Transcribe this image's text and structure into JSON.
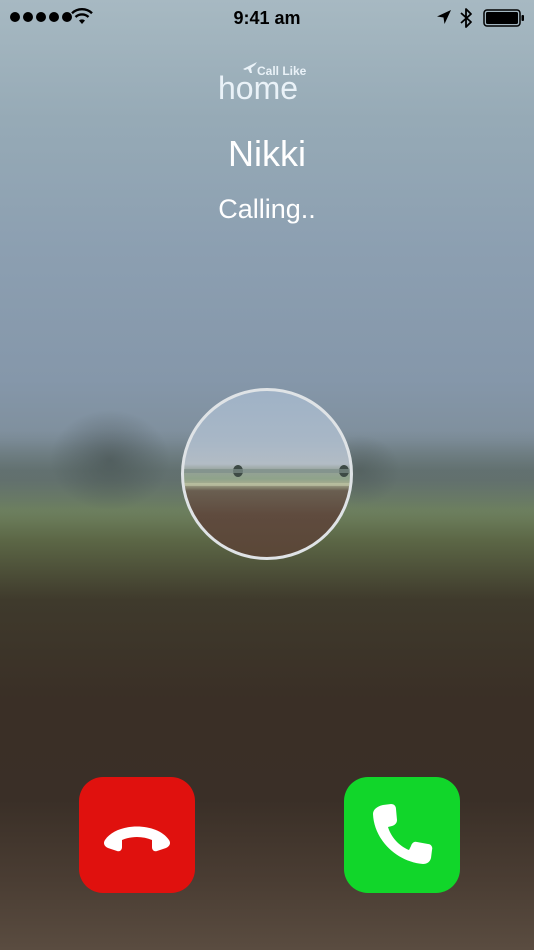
{
  "status_bar": {
    "time": "9:41 am",
    "signal_dots": 5,
    "icons": [
      "signal-dots-icon",
      "wifi-icon",
      "location-arrow-icon",
      "bluetooth-icon",
      "battery-icon"
    ]
  },
  "app": {
    "logo_tagline": "Call Like",
    "logo_word": "home"
  },
  "call": {
    "contact_name": "Nikki",
    "state": "Calling.."
  },
  "actions": {
    "decline_icon": "phone-hangup-icon",
    "accept_icon": "phone-icon"
  },
  "colors": {
    "decline": "#e0110e",
    "accept": "#11d62a",
    "text": "#ffffff"
  }
}
